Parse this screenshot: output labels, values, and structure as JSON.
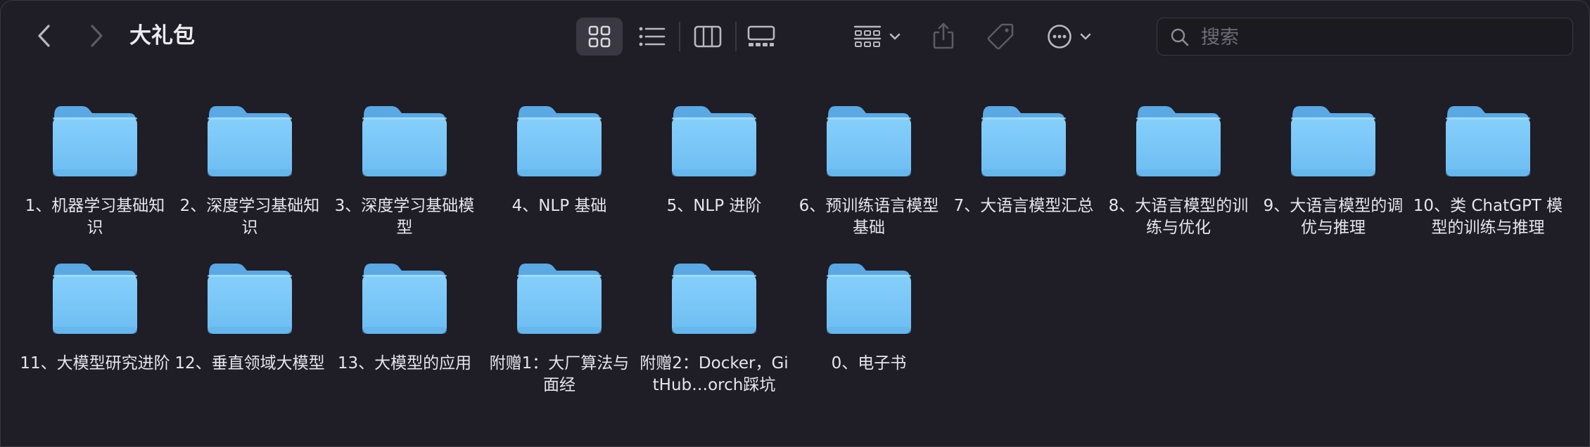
{
  "window": {
    "title": "大礼包"
  },
  "toolbar": {
    "back_icon": "chevron-left-icon",
    "forward_icon": "chevron-right-icon",
    "view_modes": [
      "icon-grid-view",
      "list-view",
      "column-view",
      "gallery-view"
    ],
    "selected_view": "icon-grid-view",
    "group_icon": "group-by-icon",
    "share_icon": "share-icon",
    "tag_icon": "tag-icon",
    "more_icon": "ellipsis-circle-icon"
  },
  "search": {
    "placeholder": "搜索",
    "value": ""
  },
  "colors": {
    "background": "#1f1d25",
    "folder": "#7ccaf8",
    "text": "#e6e6ec",
    "selected_bg": "#3a3842"
  },
  "folders": [
    {
      "name": "1、机器学习基础知识"
    },
    {
      "name": "2、深度学习基础知识"
    },
    {
      "name": "3、深度学习基础模型"
    },
    {
      "name": "4、NLP 基础"
    },
    {
      "name": "5、NLP 进阶"
    },
    {
      "name": "6、预训练语言模型基础"
    },
    {
      "name": "7、大语言模型汇总"
    },
    {
      "name": "8、大语言模型的训练与优化"
    },
    {
      "name": "9、大语言模型的调优与推理"
    },
    {
      "name": "10、类 ChatGPT 模型的训练与推理"
    },
    {
      "name": "11、大模型研究进阶"
    },
    {
      "name": "12、垂直领域大模型"
    },
    {
      "name": "13、大模型的应用"
    },
    {
      "name": "附赠1：大厂算法与面经"
    },
    {
      "name": "附赠2：Docker，GitHub…orch踩坑"
    },
    {
      "name": "0、电子书"
    }
  ]
}
